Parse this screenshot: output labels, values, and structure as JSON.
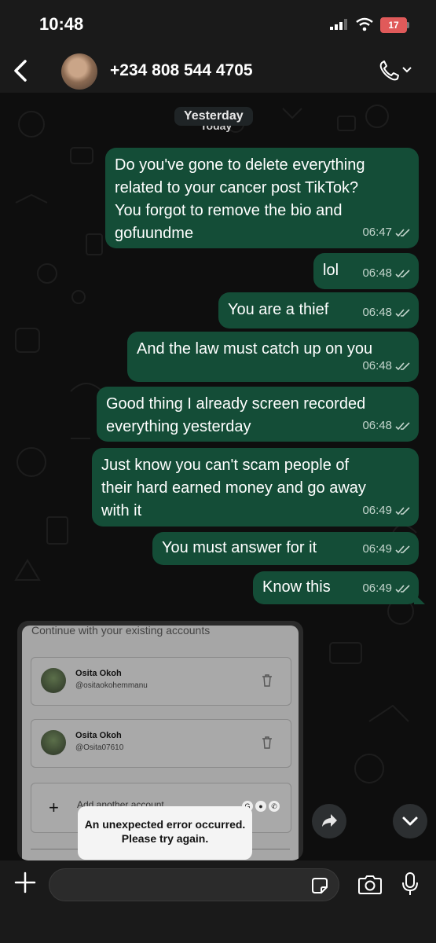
{
  "status_bar": {
    "time": "10:48",
    "battery": "17"
  },
  "header": {
    "contact": "+234 808 544 4705"
  },
  "chat": {
    "date_pill": "Yesterday",
    "date_under": "Today",
    "messages": [
      {
        "text": "Do you've gone to delete everything\nrelated to your cancer post TikTok?\nYou forgot to remove the bio and\ngofuundme",
        "time": "06:47"
      },
      {
        "text": "lol",
        "time": "06:48"
      },
      {
        "text": "You are a thief",
        "time": "06:48"
      },
      {
        "text": "And the law must catch up on you",
        "time": "06:48"
      },
      {
        "text": "Good thing I already screen recorded\neverything yesterday",
        "time": "06:48"
      },
      {
        "text": "Just know you can't scam people of\ntheir hard earned money and go away\nwith it",
        "time": "06:49"
      },
      {
        "text": "You must answer for it",
        "time": "06:49"
      },
      {
        "text": "Know this",
        "time": "06:49"
      }
    ],
    "image_message": {
      "heading": "Continue with your existing accounts",
      "accounts": [
        {
          "name": "Osita Okoh",
          "handle": "@ositaokohemmanu"
        },
        {
          "name": "Osita Okoh",
          "handle": "@Osita07610"
        }
      ],
      "add_account": "Add another account",
      "toast": "An unexpected error occurred. Please try again."
    }
  },
  "composer": {
    "placeholder": ""
  }
}
